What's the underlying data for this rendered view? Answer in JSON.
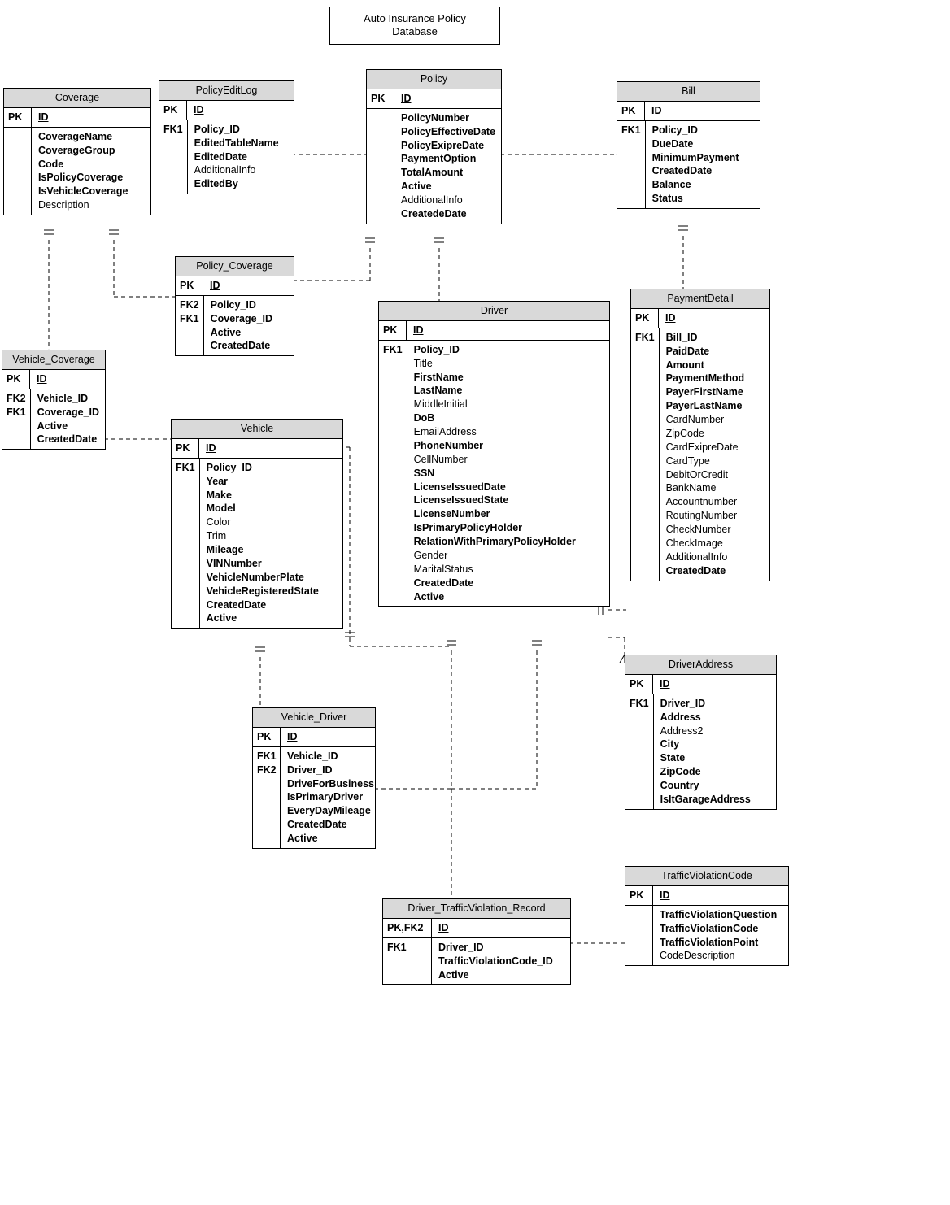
{
  "title": "Auto Insurance Policy\nDatabase",
  "entities": {
    "Coverage": {
      "name": "Coverage",
      "pk": "PK",
      "id": "ID",
      "attrs": [
        {
          "t": "CoverageName",
          "b": true
        },
        {
          "t": "CoverageGroup",
          "b": true
        },
        {
          "t": "Code",
          "b": true
        },
        {
          "t": "IsPolicyCoverage",
          "b": true
        },
        {
          "t": "IsVehicleCoverage",
          "b": true
        },
        {
          "t": "Description",
          "b": false
        }
      ]
    },
    "PolicyEditLog": {
      "name": "PolicyEditLog",
      "pk": "PK",
      "id": "ID",
      "fk": "FK1",
      "attrs": [
        {
          "t": "Policy_ID",
          "b": true
        },
        {
          "t": "EditedTableName",
          "b": true
        },
        {
          "t": "EditedDate",
          "b": true
        },
        {
          "t": "AdditionalInfo",
          "b": false
        },
        {
          "t": "EditedBy",
          "b": true
        }
      ]
    },
    "Policy": {
      "name": "Policy",
      "pk": "PK",
      "id": "ID",
      "attrs": [
        {
          "t": "PolicyNumber",
          "b": true
        },
        {
          "t": "PolicyEffectiveDate",
          "b": true
        },
        {
          "t": "PolicyExipreDate",
          "b": true
        },
        {
          "t": "PaymentOption",
          "b": true
        },
        {
          "t": "TotalAmount",
          "b": true
        },
        {
          "t": "Active",
          "b": true
        },
        {
          "t": "AdditionalInfo",
          "b": false
        },
        {
          "t": "CreatedeDate",
          "b": true
        }
      ]
    },
    "Bill": {
      "name": "Bill",
      "pk": "PK",
      "id": "ID",
      "fk": "FK1",
      "attrs": [
        {
          "t": "Policy_ID",
          "b": true
        },
        {
          "t": "DueDate",
          "b": true
        },
        {
          "t": "MinimumPayment",
          "b": true
        },
        {
          "t": "CreatedDate",
          "b": true
        },
        {
          "t": "Balance",
          "b": true
        },
        {
          "t": "Status",
          "b": true
        }
      ]
    },
    "Policy_Coverage": {
      "name": "Policy_Coverage",
      "pk": "PK",
      "id": "ID",
      "fks": "FK2\nFK1",
      "attrs": [
        {
          "t": "Policy_ID",
          "b": true
        },
        {
          "t": "Coverage_ID",
          "b": true
        },
        {
          "t": "Active",
          "b": true
        },
        {
          "t": "CreatedDate",
          "b": true
        }
      ]
    },
    "Vehicle_Coverage": {
      "name": "Vehicle_Coverage",
      "pk": "PK",
      "id": "ID",
      "fks": "FK2\nFK1",
      "attrs": [
        {
          "t": "Vehicle_ID",
          "b": true
        },
        {
          "t": "Coverage_ID",
          "b": true
        },
        {
          "t": "Active",
          "b": true
        },
        {
          "t": "CreatedDate",
          "b": true
        }
      ]
    },
    "Vehicle": {
      "name": "Vehicle",
      "pk": "PK",
      "id": "ID",
      "fk": "FK1",
      "attrs": [
        {
          "t": "Policy_ID",
          "b": true
        },
        {
          "t": "Year",
          "b": true
        },
        {
          "t": "Make",
          "b": true
        },
        {
          "t": "Model",
          "b": true
        },
        {
          "t": "Color",
          "b": false
        },
        {
          "t": "Trim",
          "b": false
        },
        {
          "t": "Mileage",
          "b": true
        },
        {
          "t": "VINNumber",
          "b": true
        },
        {
          "t": "VehicleNumberPlate",
          "b": true
        },
        {
          "t": "VehicleRegisteredState",
          "b": true
        },
        {
          "t": "CreatedDate",
          "b": true
        },
        {
          "t": "Active",
          "b": true
        }
      ]
    },
    "Driver": {
      "name": "Driver",
      "pk": "PK",
      "id": "ID",
      "fk": "FK1",
      "attrs": [
        {
          "t": "Policy_ID",
          "b": true
        },
        {
          "t": "Title",
          "b": false
        },
        {
          "t": "FirstName",
          "b": true
        },
        {
          "t": "LastName",
          "b": true
        },
        {
          "t": "MiddleInitial",
          "b": false
        },
        {
          "t": "DoB",
          "b": true
        },
        {
          "t": "EmailAddress",
          "b": false
        },
        {
          "t": "PhoneNumber",
          "b": true
        },
        {
          "t": "CellNumber",
          "b": false
        },
        {
          "t": "SSN",
          "b": true
        },
        {
          "t": "LicenseIssuedDate",
          "b": true
        },
        {
          "t": "LicenseIssuedState",
          "b": true
        },
        {
          "t": "LicenseNumber",
          "b": true
        },
        {
          "t": "IsPrimaryPolicyHolder",
          "b": true
        },
        {
          "t": "RelationWithPrimaryPolicyHolder",
          "b": true
        },
        {
          "t": "Gender",
          "b": false
        },
        {
          "t": "MaritalStatus",
          "b": false
        },
        {
          "t": "CreatedDate",
          "b": true
        },
        {
          "t": "Active",
          "b": true
        }
      ]
    },
    "PaymentDetail": {
      "name": "PaymentDetail",
      "pk": "PK",
      "id": "ID",
      "fk": "FK1",
      "attrs": [
        {
          "t": "Bill_ID",
          "b": true
        },
        {
          "t": "PaidDate",
          "b": true
        },
        {
          "t": "Amount",
          "b": true
        },
        {
          "t": "PaymentMethod",
          "b": true
        },
        {
          "t": "PayerFirstName",
          "b": true
        },
        {
          "t": "PayerLastName",
          "b": true
        },
        {
          "t": "CardNumber",
          "b": false
        },
        {
          "t": "ZipCode",
          "b": false
        },
        {
          "t": "CardExipreDate",
          "b": false
        },
        {
          "t": "CardType",
          "b": false
        },
        {
          "t": "DebitOrCredit",
          "b": false
        },
        {
          "t": "BankName",
          "b": false
        },
        {
          "t": "Accountnumber",
          "b": false
        },
        {
          "t": "RoutingNumber",
          "b": false
        },
        {
          "t": "CheckNumber",
          "b": false
        },
        {
          "t": "CheckImage",
          "b": false
        },
        {
          "t": "AdditionalInfo",
          "b": false
        },
        {
          "t": "CreatedDate",
          "b": true
        }
      ]
    },
    "Vehicle_Driver": {
      "name": "Vehicle_Driver",
      "pk": "PK",
      "id": "ID",
      "fks": "FK1\nFK2",
      "attrs": [
        {
          "t": "Vehicle_ID",
          "b": true
        },
        {
          "t": "Driver_ID",
          "b": true
        },
        {
          "t": "DriveForBusiness",
          "b": true
        },
        {
          "t": "IsPrimaryDriver",
          "b": true
        },
        {
          "t": "EveryDayMileage",
          "b": true
        },
        {
          "t": "CreatedDate",
          "b": true
        },
        {
          "t": "Active",
          "b": true
        }
      ]
    },
    "DriverAddress": {
      "name": "DriverAddress",
      "pk": "PK",
      "id": "ID",
      "fk": "FK1",
      "attrs": [
        {
          "t": "Driver_ID",
          "b": true
        },
        {
          "t": "Address",
          "b": true
        },
        {
          "t": "Address2",
          "b": false
        },
        {
          "t": "City",
          "b": true
        },
        {
          "t": "State",
          "b": true
        },
        {
          "t": "ZipCode",
          "b": true
        },
        {
          "t": "Country",
          "b": true
        },
        {
          "t": "IsItGarageAddress",
          "b": true
        }
      ]
    },
    "Driver_TrafficViolation_Record": {
      "name": "Driver_TrafficViolation_Record",
      "pk": "PK,FK2",
      "id": "ID",
      "fk": "FK1",
      "attrs": [
        {
          "t": "Driver_ID",
          "b": true
        },
        {
          "t": "TrafficViolationCode_ID",
          "b": true
        },
        {
          "t": "Active",
          "b": true
        }
      ]
    },
    "TrafficViolationCode": {
      "name": "TrafficViolationCode",
      "pk": "PK",
      "id": "ID",
      "attrs": [
        {
          "t": "TrafficViolationQuestion",
          "b": true
        },
        {
          "t": "TrafficViolationCode",
          "b": true
        },
        {
          "t": "TrafficViolationPoint",
          "b": true
        },
        {
          "t": "CodeDescription",
          "b": false
        }
      ]
    }
  }
}
